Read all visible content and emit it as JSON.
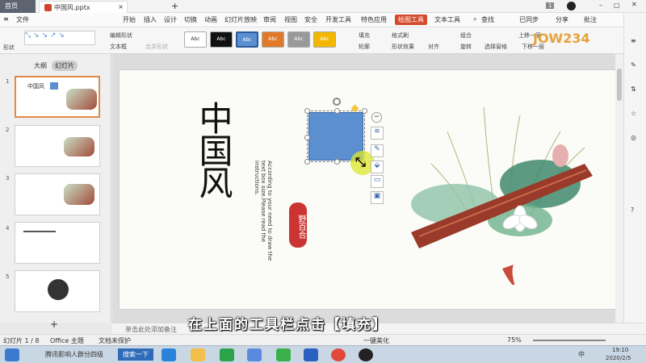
{
  "titlebar": {
    "home_tab": "首页",
    "file_tab": "中国风.pptx",
    "badge": "1"
  },
  "menubar": {
    "file_menu": "文件",
    "items": [
      "开始",
      "插入",
      "设计",
      "切换",
      "动画",
      "幻灯片放映",
      "审阅",
      "视图",
      "安全",
      "开发工具",
      "特色应用",
      "绘图工具",
      "文本工具"
    ],
    "search": "查找",
    "sync": "已同步",
    "share": "分享",
    "annotate": "批注"
  },
  "ribbon": {
    "shape": "形状",
    "edit_shape": "编辑形状",
    "textbox": "文本框",
    "merge_shape": "合并形状",
    "styles": [
      "Abc",
      "Abc",
      "Abc",
      "Abc",
      "Abc",
      "Abc"
    ],
    "fill": "填充",
    "format_brush": "格式刷",
    "outline": "轮廓",
    "shape_effect": "形状效果",
    "align": "对齐",
    "group": "组合",
    "rotate": "旋转",
    "selection_pane": "选择窗格",
    "bring_forward": "上移一层",
    "send_backward": "下移一层",
    "watermark": "JOW234"
  },
  "leftpane": {
    "tab_outline": "大纲",
    "tab_slides": "幻灯片",
    "slide_numbers": [
      "1",
      "2",
      "3",
      "4",
      "5"
    ],
    "add": "+"
  },
  "slide": {
    "title": "中国风",
    "subtitle": "According to your need to draw the text box size.Please read the instructions.",
    "seal": "野百合"
  },
  "notes": {
    "placeholder": "单击此处添加备注"
  },
  "statusbar": {
    "slide_count": "幻灯片 1 / 8",
    "theme": "Office 主题",
    "protect": "文档未保护",
    "beautify": "一键美化",
    "zoom": "75%"
  },
  "taskbar": {
    "ie_label": "腾讯影响人群分四级",
    "search": "搜索一下",
    "time": "19:10",
    "date": "2020/2/5",
    "lang": "中"
  },
  "caption": "在上面的工具栏点击【填充】",
  "colors": {
    "accent": "#d44a2a",
    "shape_fill": "#5b8fd0",
    "shape_border": "#3a6aa8"
  }
}
